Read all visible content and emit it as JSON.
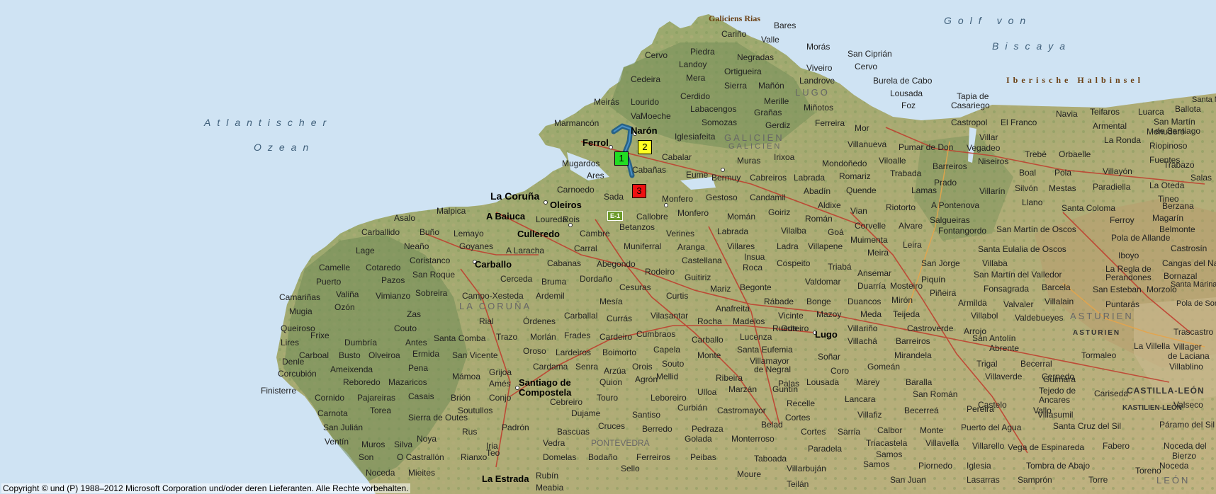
{
  "colors": {
    "sea": "#cfe3f3",
    "land": "#9aa36a",
    "highland": "#6f8b55",
    "road": "#c0392b",
    "route": "#1b5a88",
    "marker_1": "#22dd22",
    "marker_2": "#ffff22",
    "marker_3": "#ee1111"
  },
  "copyright": "Copyright © und (P) 1988–2012 Microsoft Corporation und/oder deren Lieferanten. Alle Rechte vorbehalten.",
  "road_shield": "E-1",
  "markers": [
    {
      "label": "1",
      "color": "#22dd22"
    },
    {
      "label": "2",
      "color": "#ffff22"
    },
    {
      "label": "3",
      "color": "#ee1111"
    }
  ],
  "labels": {
    "sea_atlantic_1": "Atlantischer",
    "sea_atlantic_2": "Ozean",
    "sea_biscay_1": "Golf von",
    "sea_biscay_2": "Biscaya",
    "rias": "Galiciens Rias",
    "iberische": "Iberische Halbinsel",
    "galicien_1": "GALICIEN",
    "galicien_2": "GALICIEN",
    "lugo_region": "LUGO",
    "coruna_region": "LA CORUÑA",
    "pontevedra_region": "PONTEVEDRA",
    "asturien_1": "ASTURIEN",
    "asturien_2": "ASTURIEN",
    "castilla": "CASTILLA-LEÓN",
    "kastilien": "KASTILIEN-LEÓN",
    "leon": "LEÓN",
    "ferrol": "Ferrol",
    "naron": "Narón",
    "coruna": "La Coruña",
    "baiuca": "A Baiuca",
    "oleiros": "Oleiros",
    "culleredo": "Culleredo",
    "carballo": "Carballo",
    "santiago_1": "Santiago de",
    "santiago_2": "Compostela",
    "lugo": "Lugo",
    "estrada": "La Estrada",
    "bares": "Bares",
    "carino": "Cariño",
    "valle": "Valle",
    "cervo": "Cervo",
    "piedra": "Piedra",
    "negradas": "Negradas",
    "moras": "Morás",
    "sanciprian": "San Ciprián",
    "cedeira": "Cedeira",
    "landoy": "Landoy",
    "ortigueira": "Ortigueira",
    "vivero": "Viveiro",
    "cervo2": "Cervo",
    "mera": "Mera",
    "sierra": "Sierra",
    "manon": "Mañón",
    "landrove": "Landrove",
    "burela": "Burela de Cabo",
    "lousada_n": "Lousada",
    "meiras": "Meirás",
    "lourido": "Lourido",
    "cerdido": "Cerdido",
    "merille": "Merille",
    "foz": "Foz",
    "tapia": "Tapia de",
    "casariego": "Casariego",
    "valmoeche": "Val",
    "moeche": "Moeche",
    "labacengos": "Labacengos",
    "granas": "Grañas",
    "minotos": "Miñotos",
    "marmancon": "Marmancón",
    "somozas": "Somozas",
    "gerdiz": "Gerdiz",
    "ferreira": "Ferreira",
    "mor": "Mor",
    "castropol": "Castropol",
    "elfranco": "El Franco",
    "navia": "Navia",
    "teifaros": "Teifaros",
    "luarca": "Luarca",
    "ballota": "Ballota",
    "santamarina": "Santa Marina",
    "iglesiafeita": "Iglesiafeita",
    "villanueva": "Villanueva",
    "pumar": "Pumar de Don",
    "vegadeo": "Vegadeo",
    "villar": "Villar",
    "armental": "Armental",
    "menudero": "Menudero",
    "sanmartin_s": "San Martín",
    "desantiago": "de Santiago",
    "mugardos": "Mugardos",
    "cabalar": "Cabalar",
    "muras": "Muras",
    "irixoa": "Irixoa",
    "mondonedo": "Mondoñedo",
    "viloalle": "Viloalle",
    "trebe": "Trebé",
    "orbaelle": "Orbaelle",
    "laronda": "La Ronda",
    "riopinoso": "Riopinoso",
    "ares": "Ares",
    "cabanas": "Cabañas",
    "eume": "Eume",
    "bermuy": "Bermuy",
    "cabreiros": "Cabreiros",
    "labrada": "Labrada",
    "barreiros": "Barreiros",
    "niseiros": "Niseiros",
    "boal": "Boal",
    "pola": "Pola",
    "villayon": "Villayón",
    "fuentes": "Fuentes",
    "trabazo": "Trabazo",
    "carnoedo": "Carnoedo",
    "sada": "Sada",
    "monfero": "Monfero",
    "gestoso": "Gestoso",
    "candamil": "Candamil",
    "abadin": "Abadín",
    "quende": "Quende",
    "romariz": "Romariz",
    "trabada": "Trabada",
    "lamas": "Lamas",
    "prado": "Prado",
    "villarin": "Villarín",
    "silvon": "Silvón",
    "mestas": "Mestas",
    "paradiella": "Paradiella",
    "laoteda": "La Oteda",
    "salas": "Salas",
    "malpica": "Malpica",
    "rois": "Rois",
    "callobre": "Callobre",
    "betanzos": "Betanzos",
    "monfero2": "Monfero",
    "moman": "Momán",
    "goiriz": "Goiriz",
    "aldixe": "Aldixe",
    "vian": "Vian",
    "riotorto": "Riotorto",
    "aponte": "A Pontenova",
    "llano": "Llano",
    "santacoloma": "Santa Coloma",
    "tineo": "Tineo",
    "berzana": "Berzana",
    "asalo": "Asalo",
    "loureda": "Loureda",
    "ferroy": "Ferroy",
    "magarin": "Magarín",
    "carballido": "Carballido",
    "buno": "Buño",
    "lemayo": "Lemayo",
    "cambre": "Cambre",
    "verines": "Verines",
    "labrada2": "Labrada",
    "roman": "Román",
    "corvelle": "Corvelle",
    "alvare": "Alvare",
    "salgueiras": "Salgueiras",
    "fontangordo": "Fontangordo",
    "sanmartinoscos": "San Martín de Oscos",
    "belmonte": "Belmonte",
    "lage": "Lage",
    "neaño": "Neaño",
    "goyanes": "Goyanes",
    "alaracha": "A Laracha",
    "carral": "Carral",
    "muniferral": "Muniferral",
    "aranga": "Aranga",
    "villares": "Villares",
    "ladra": "Ladra",
    "villapene": "Villapene",
    "vilalba": "Vilalba",
    "goa": "Goá",
    "muimenta": "Muimenta",
    "leira": "Leira",
    "santaeulalia": "Santa Eulalia de Oscos",
    "poladeallande": "Pola de Allande",
    "castrosin": "Castrosín",
    "coristanco": "Coristanco",
    "cabanas2": "Cabanas",
    "abegondo": "Abegondo",
    "castellana": "Castellana",
    "insua": "Insua",
    "roca": "Roca",
    "cospeito": "Cospeito",
    "triaba": "Triabá",
    "meira": "Meira",
    "villaba": "Villaba",
    "ibiyo": "Iboyo",
    "cangas": "Cangas del Narcea",
    "camelle": "Camelle",
    "cotaredo": "Cotaredo",
    "rodeiro": "Rodeiro",
    "guitiriz": "Guitiriz",
    "ansemar": "Ansemar",
    "sanjorge": "San Jorge",
    "sanmartinvalledor": "San Martín del Valledor",
    "lareglade": "La Regla de",
    "perandones": "Perandones",
    "bornazal": "Bornazal",
    "puerto": "Puerto",
    "pazos": "Pazos",
    "sanroque": "San Roque",
    "cerceda": "Cerceda",
    "bruma": "Bruma",
    "dordano": "Dordaño",
    "valdomar": "Valdomar",
    "duarria": "Duarría",
    "piquin": "Piquín",
    "camarinas": "Camariñas",
    "valina": "Valiña",
    "vimianzo": "Vimianzo",
    "sobreira": "Sobreira",
    "campoxesteda": "Campo-Xesteda",
    "ardemil": "Ardemil",
    "mesia": "Mesía",
    "cesuras": "Cesuras",
    "curtis": "Curtis",
    "mariz": "Mariz",
    "begonte": "Begonte",
    "mosteiro": "Mosteiro",
    "pineira": "Piñeira",
    "fonsagrada": "Fonsagrada",
    "barcela": "Barcela",
    "sanesteban": "San Esteban",
    "morzolo": "Morzolo",
    "poladesomiedo": "Pola de Somiedo",
    "mugia": "Mugia",
    "ozon": "Ozón",
    "zas": "Zas",
    "rial": "Rial",
    "ordenes": "Órdenes",
    "carballal": "Carballal",
    "anafreita": "Anafreita",
    "rabade": "Rábade",
    "bonge": "Bonge",
    "duancos": "Duancos",
    "miron": "Mirón",
    "armilda": "Armilda",
    "valvaler": "Valvaler",
    "villalain": "Villalain",
    "puntarias": "Puntarás",
    "santamarina2": "Santa Marina",
    "vilasantar": "Vilasantar",
    "rocha": "Rocha",
    "madelos": "Madelos",
    "vicinte": "Vicinte",
    "mazoy": "Mazoy",
    "meda": "Meda",
    "teijeda": "Teijeda",
    "villabol": "Villabol",
    "valdebueyes": "Valdebueyes",
    "queiroso": "Queiroso",
    "frixe": "Frixe",
    "couto": "Couto",
    "trazo": "Trazo",
    "curras": "Currás",
    "rueda": "Rueda",
    "villariño": "Villariño",
    "castroverde": "Castroverde",
    "arrojo": "Arrojo",
    "trascastro": "Trascastro",
    "lires": "Lires",
    "dumbria": "Dumbría",
    "antes": "Antes",
    "santacomba": "Santa Comba",
    "morlan": "Morlán",
    "frades": "Frades",
    "cardeiro": "Cardeiro",
    "cumbraos": "Cumbraos",
    "carballo2": "Carballo",
    "lucenza": "Lucenza",
    "villacha": "Villachá",
    "barreiros2": "Barreiros",
    "sanantolin": "San Antolín",
    "abrente": "Abrente",
    "lavillella": "La Villella",
    "carboal": "Carboal",
    "busto": "Busto",
    "olveiroa": "Olveiroa",
    "ermida": "Ermida",
    "oroso": "Oroso",
    "capela": "Capela",
    "santaeufemia": "Santa Eufemia",
    "villameiro": "Villamayor",
    "denegral": "de Negral",
    "sonar": "Soñar",
    "mirandela": "Mirandela",
    "trigal": "Trigal",
    "becerral": "Becerral",
    "tormaleo": "Tormaleo",
    "villager": "Villager",
    "delaciana": "de Laciana",
    "denle": "Denle",
    "corcubion": "Corcubión",
    "ameixenda": "Ameixenda",
    "pena": "Pena",
    "sanvicente": "San Vicente",
    "lardeiros": "Lardeiros",
    "boimorto": "Boimorto",
    "souto": "Souto",
    "monte": "Monte",
    "outeiro": "Outeiro",
    "coro": "Coro",
    "gomean": "Gomeán",
    "villaverde": "Villaverde",
    "cernedo": "Cernedo",
    "villablino": "Villablino",
    "reboredo": "Reboredo",
    "mazaricos": "Mazaricos",
    "mamoa": "Mámoa",
    "grijoa": "Grijoa",
    "cardama": "Cardama",
    "senra": "Senra",
    "arzua": "Arzúa",
    "orois": "Orois",
    "mellid": "Mellid",
    "ribeira": "Ribeira",
    "palas": "Palas",
    "baralla": "Baralla",
    "guimara": "Guimara",
    "finisterre": "Finisterre",
    "ames": "Amés",
    "quion": "Quion",
    "agron": "Agrón",
    "marzan": "Marzán",
    "guntin": "Guntín",
    "lousada": "Lousada",
    "marey": "Marey",
    "sanroman": "San Román",
    "tejedo": "Tejedo de",
    "ancares": "Ancares",
    "cariseda": "Cariseda",
    "castillaleon": "CASTILLA-LEÓN",
    "cornido": "Cornido",
    "pajareiras": "Pajareiras",
    "casais": "Casais",
    "brion": "Brión",
    "conjo": "Conjo",
    "cebreiro": "Cebreiro",
    "touro": "Touro",
    "leboreiro": "Leboreiro",
    "ulloa": "Ulloa",
    "recelle": "Recelle",
    "lancara": "Lancara",
    "samos": "Samos",
    "castelo": "Castelo",
    "vallo": "Vallo",
    "valseco": "Valseco",
    "carnota": "Carnota",
    "torea": "Torea",
    "sierradeoutes": "Sierra de Outes",
    "soutullos": "Soutullos",
    "dujame": "Dujame",
    "santiso": "Santiso",
    "curbian": "Curbián",
    "castromayor": "Castromayor",
    "cortes": "Cortes",
    "villafiz": "Villafiz",
    "becerrea": "Becerreá",
    "pereira": "Pereira",
    "villasumil": "Villasumil",
    "paramodelsil": "Páramo del Sil",
    "sanjulian": "San Julián",
    "ruslabel": "Rus",
    "padron": "Padrón",
    "bascuas": "Bascuas",
    "cruces": "Cruces",
    "berredo": "Berredo",
    "pedraza": "Pedraza",
    "belad": "Belad",
    "cortes2": "Cortes",
    "sarria": "Sarria",
    "calbor": "Calbor",
    "montelabel": "Monte",
    "puertodelagua": "Puerto del Agua",
    "santacruz": "Santa Cruz del Sil",
    "ventin": "Ventín",
    "muros": "Muros",
    "silva": "Silva",
    "noya": "Noya",
    "riralab": "Iria",
    "vedra": "Vedra",
    "golada": "Golada",
    "monterroso": "Monterroso",
    "paradela": "Paradela",
    "triacastela": "Triacastela",
    "villavella": "Villavella",
    "villarello": "Villarello",
    "vegadeespinareda": "Vega de Espinareda",
    "fabero": "Fabero",
    "nocedadel": "Noceda del",
    "bierzo": "Bierzo",
    "son": "Son",
    "ocastrallon": "O Castrallón",
    "rianxo": "Rianxo",
    "teo": "Teo",
    "domelas": "Domelas",
    "bodano": "Bodaño",
    "ferreiros": "Ferreiros",
    "peibas": "Peibas",
    "taboada": "Taboada",
    "piornedo": "Piornedo",
    "iglesia": "Iglesia",
    "tombradeabajo": "Tombra de Abajo",
    "noceda": "Noceda",
    "mieites": "Mieites",
    "rubin": "Rubín",
    "sello": "Sello",
    "moure": "Moure",
    "villarbujan": "Villarbuján",
    "sanjuan": "San Juan",
    "lasarras": "Lasarras",
    "sampron": "Samprón",
    "torre": "Torre",
    "toreno": "Toreno",
    "meabia": "Meabia",
    "teilan": "Teilán"
  }
}
